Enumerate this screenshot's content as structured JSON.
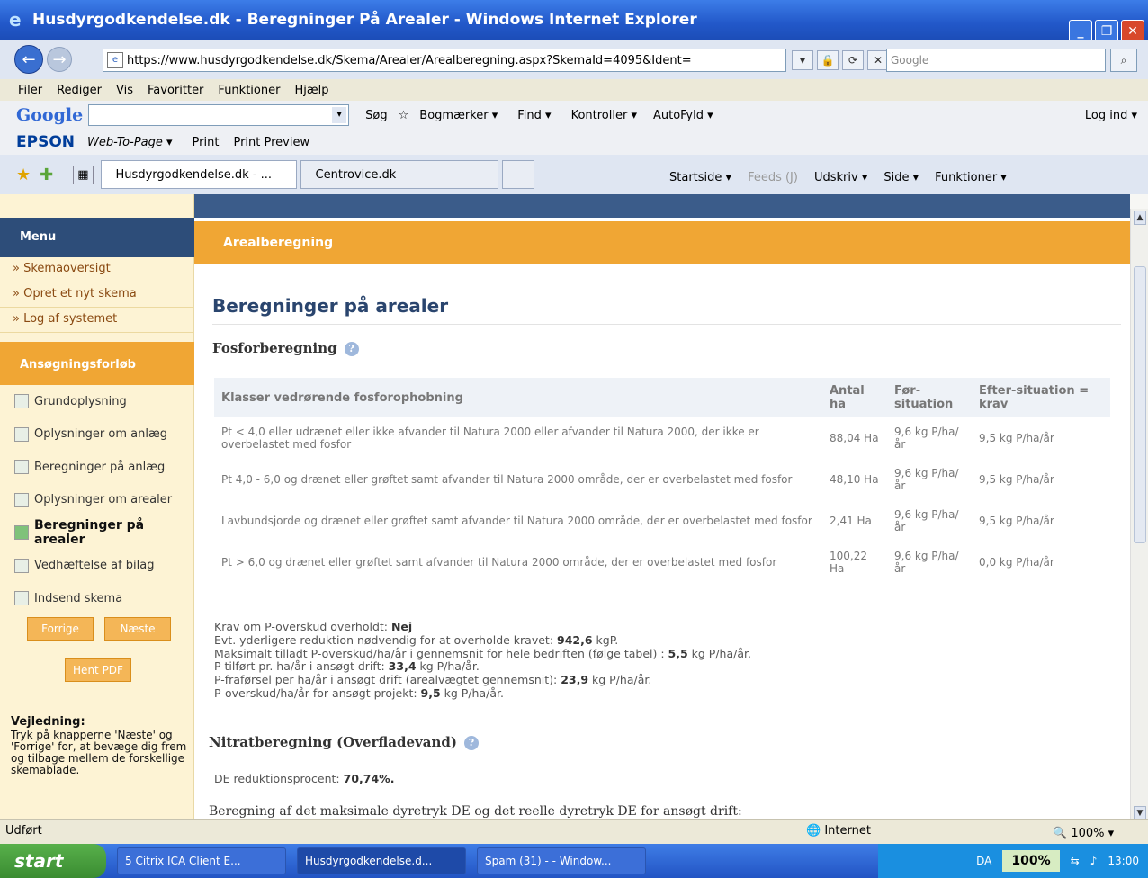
{
  "window": {
    "title": "Husdyrgodkendelse.dk - Beregninger På Arealer - Windows Internet Explorer"
  },
  "address": {
    "url": "https://www.husdyrgodkendelse.dk/Skema/Arealer/Arealberegning.aspx?SkemaId=4095&Ident=",
    "search_placeholder": "Google"
  },
  "menubar": [
    "Filer",
    "Rediger",
    "Vis",
    "Favoritter",
    "Funktioner",
    "Hjælp"
  ],
  "googlebar": {
    "logo": "Google",
    "sog": "Søg",
    "bogmaerker": "Bogmærker ▾",
    "find": "Find ▾",
    "kontroller": "Kontroller ▾",
    "autofyld": "AutoFyld ▾",
    "login": "Log ind ▾"
  },
  "epsonbar": {
    "brand": "EPSON",
    "wtp": "Web-To-Page ▾",
    "print": "Print",
    "print_preview": "Print Preview"
  },
  "tabs": [
    {
      "label": "Husdyrgodkendelse.dk - ..."
    },
    {
      "label": "Centrovice.dk"
    }
  ],
  "cmdbar": {
    "startside": "Startside ▾",
    "feeds": "Feeds (J)",
    "udskriv": "Udskriv ▾",
    "side": "Side ▾",
    "funktioner": "Funktioner ▾"
  },
  "sidebar": {
    "menu_title": "Menu",
    "menu_items": [
      "» Skemaoversigt",
      "» Opret et nyt skema",
      "» Log af systemet"
    ],
    "process_title": "Ansøgningsforløb",
    "steps": [
      "Grundoplysning",
      "Oplysninger om anlæg",
      "Beregninger på anlæg",
      "Oplysninger om arealer",
      "Beregninger på arealer",
      "Vedhæftelse af bilag",
      "Indsend skema"
    ],
    "prev": "Forrige",
    "next": "Næste",
    "pdf": "Hent PDF",
    "guide_title": "Vejledning:",
    "guide_text": "Tryk på knapperne 'Næste' og 'Forrige' for, at bevæge dig frem og tilbage mellem de forskellige skemablade."
  },
  "content": {
    "section_header": "Arealberegning",
    "title": "Beregninger på arealer",
    "fosfor_title": "Fosforberegning",
    "table": {
      "headers": [
        "Klasser vedrørende fosforophobning",
        "Antal ha",
        "Før-situation",
        "Efter-situation = krav"
      ],
      "rows": [
        [
          "Pt < 4,0 eller udrænet eller ikke afvander til Natura 2000 eller afvander til Natura 2000, der ikke er overbelastet med fosfor",
          "88,04 Ha",
          "9,6 kg P/ha/år",
          "9,5 kg P/ha/år"
        ],
        [
          "Pt 4,0 - 6,0 og drænet eller grøftet samt afvander til Natura 2000 område, der er overbelastet med fosfor",
          "48,10 Ha",
          "9,6 kg P/ha/år",
          "9,5 kg P/ha/år"
        ],
        [
          "Lavbundsjorde og drænet eller grøftet samt afvander til Natura 2000 område, der er overbelastet med fosfor",
          "2,41 Ha",
          "9,6 kg P/ha/år",
          "9,5 kg P/ha/år"
        ],
        [
          "Pt > 6,0 og drænet eller grøftet samt afvander til Natura 2000 område, der er overbelastet med fosfor",
          "100,22 Ha",
          "9,6 kg P/ha/år",
          "0,0 kg P/ha/år"
        ]
      ]
    },
    "summary": {
      "l1_label": "Krav om P-overskud overholdt: ",
      "l1_val": "Nej",
      "l2_label": "Evt. yderligere reduktion nødvendig for at overholde kravet: ",
      "l2_val": "942,6",
      "l2_unit": " kgP.",
      "l3_label": "Maksimalt tilladt P-overskud/ha/år i gennemsnit for hele bedriften (følge tabel) : ",
      "l3_val": "5,5",
      "l3_unit": " kg P/ha/år.",
      "l4_label": "P tilført pr. ha/år i ansøgt drift: ",
      "l4_val": "33,4",
      "l4_unit": " kg P/ha/år.",
      "l5_label": "P-fraførsel per ha/år i ansøgt drift (arealvægtet gennemsnit): ",
      "l5_val": "23,9",
      "l5_unit": " kg P/ha/år.",
      "l6_label": "P-overskud/ha/år for ansøgt projekt: ",
      "l6_val": "9,5",
      "l6_unit": " kg P/ha/år."
    },
    "nitrat_title": "Nitratberegning (Overfladevand)",
    "de_label": "DE reduktionsprocent: ",
    "de_val": "70,74%.",
    "beregning": "Beregning af det maksimale dyretryk DE       og det reelle dyretryk DE     for ansøgt drift:"
  },
  "status": {
    "left": "Udført",
    "zone": "Internet",
    "zoom": "100%"
  },
  "taskbar": {
    "start": "start",
    "t1": "5 Citrix ICA Client E...",
    "t2": "Husdyrgodkendelse.d...",
    "t3": "Spam (31) - - Window...",
    "lang": "DA",
    "pct": "100%",
    "clock": "13:00"
  },
  "colors": {
    "accent": "#f0a634",
    "nav": "#2d4d79",
    "title_blue": "#2a456e"
  }
}
